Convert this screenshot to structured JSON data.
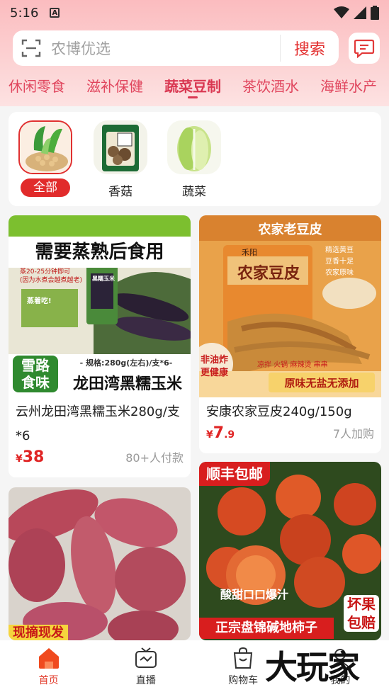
{
  "status": {
    "time": "5:16",
    "notif": "A"
  },
  "search": {
    "placeholder": "农博优选",
    "button": "搜索"
  },
  "tabs": [
    {
      "label": "休闲零食"
    },
    {
      "label": "滋补保健"
    },
    {
      "label": "蔬菜豆制"
    },
    {
      "label": "茶饮酒水"
    },
    {
      "label": "海鲜水产"
    }
  ],
  "categories": [
    {
      "label": "全部"
    },
    {
      "label": "香菇"
    },
    {
      "label": "蔬菜"
    }
  ],
  "products": [
    {
      "title": "云州龙田湾黑糯玉米280g/支*6",
      "price_int": "38",
      "price_dec": "",
      "sales": "80+人付款",
      "banner": "需要蒸熟后食用",
      "note1": "蒸20-25分钟即可",
      "note2": "(因为水煮会越煮越老)",
      "tag": "雪路食味",
      "spec": "- 规格:280g(左右)/支*6-",
      "name": "龙田湾黑糯玉米",
      "pack": "黑糯玉米",
      "steam": "蒸着吃!"
    },
    {
      "title": "安康农家豆皮240g/150g",
      "price_int": "7",
      "price_dec": ".9",
      "sales": "7人加购",
      "banner": "农家老豆皮",
      "bag_brand": "禾阳",
      "bag": "农家豆皮",
      "check1": "精选黄豆",
      "check2": "豆香十足",
      "check3": "农家原味",
      "tag": "非油炸更健康",
      "uses": "凉拌  火锅  麻辣烫  串串",
      "slogan": "原味无盐无添加"
    },
    {
      "title": "",
      "banner": "现摘现发"
    },
    {
      "title": "",
      "banner": "顺丰包邮",
      "slogan1": "酸甜口口爆汁",
      "slogan2": "正宗盘锦碱地柿子",
      "badge": "坏果包赔"
    }
  ],
  "nav": [
    {
      "label": "首页"
    },
    {
      "label": "直播"
    },
    {
      "label": "购物车"
    },
    {
      "label": "我的"
    }
  ],
  "watermark": "大玩家",
  "colors": {
    "accent": "#e02424",
    "tab": "#e0455d",
    "header": "#fbbcbf"
  }
}
